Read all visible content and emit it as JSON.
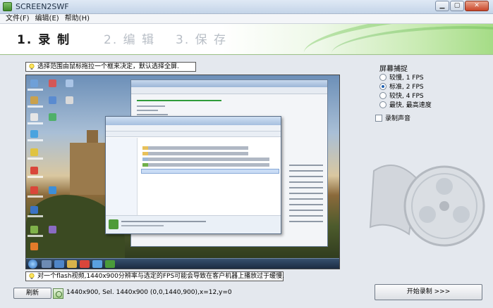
{
  "window": {
    "title": "SCREEN2SWF"
  },
  "menu": [
    {
      "label": "文件(F)"
    },
    {
      "label": "编辑(E)"
    },
    {
      "label": "帮助(H)"
    }
  ],
  "steps": [
    {
      "label": "1. 录 制",
      "active": true
    },
    {
      "label": "2. 编 辑",
      "active": false
    },
    {
      "label": "3. 保 存",
      "active": false
    }
  ],
  "hints": {
    "top": "选择范围由鼠标拖拉一个框来决定，默认选择全屏.",
    "bottom": "对一个flash视频,1440x900分辨率与选定的FPS可能会导致在客户机器上播放过于缓慢."
  },
  "capture": {
    "title": "屏幕捕捉",
    "options": [
      {
        "label": "较慢, 1 FPS",
        "selected": false
      },
      {
        "label": "标准, 2 FPS",
        "selected": true
      },
      {
        "label": "较快, 4 FPS",
        "selected": false
      },
      {
        "label": "最快, 最高速度",
        "selected": false
      }
    ],
    "record_audio_label": "录制声音",
    "record_audio_checked": false
  },
  "buttons": {
    "refresh": "刷新",
    "start_recording": "开始录制 >>>"
  },
  "status": "1440x900, Sel. 1440x900 (0,0,1440,900),x=12,y=0",
  "colors": {
    "accent_green": "#a5dc86",
    "selected_radio": "#1f5fb0"
  }
}
